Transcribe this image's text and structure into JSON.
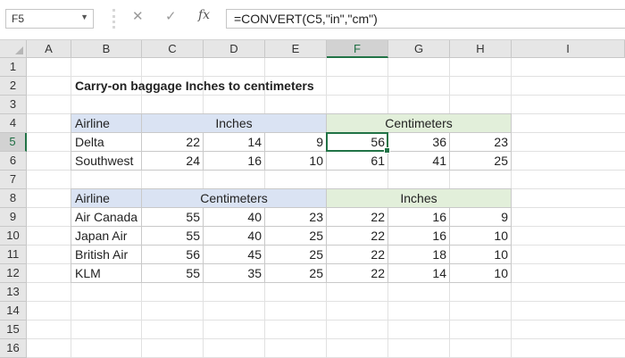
{
  "name_box": {
    "value": "F5",
    "dropdown_icon": "chevron-down-icon"
  },
  "formula_bar": {
    "cancel_icon": "close-icon",
    "enter_icon": "check-icon",
    "fx_label": "fx",
    "formula": "=CONVERT(C5,\"in\",\"cm\")"
  },
  "columns": [
    "A",
    "B",
    "C",
    "D",
    "E",
    "F",
    "G",
    "H",
    "I"
  ],
  "rows": [
    "1",
    "2",
    "3",
    "4",
    "5",
    "6",
    "7",
    "8",
    "9",
    "10",
    "11",
    "12",
    "13",
    "14",
    "15",
    "16"
  ],
  "selected": {
    "column": "F",
    "row": "5"
  },
  "colors": {
    "accent": "#217346",
    "blue_header": "#dae3f3",
    "green_header": "#e2efda"
  },
  "title": "Carry-on baggage Inches to centimeters",
  "table1": {
    "airline_header": "Airline",
    "group1_header": "Inches",
    "group2_header": "Centimeters",
    "rows": [
      {
        "airline": "Delta",
        "a": "22",
        "b": "14",
        "c": "9",
        "d": "56",
        "e": "36",
        "f": "23"
      },
      {
        "airline": "Southwest",
        "a": "24",
        "b": "16",
        "c": "10",
        "d": "61",
        "e": "41",
        "f": "25"
      }
    ]
  },
  "table2": {
    "airline_header": "Airline",
    "group1_header": "Centimeters",
    "group2_header": "Inches",
    "rows": [
      {
        "airline": "Air Canada",
        "a": "55",
        "b": "40",
        "c": "23",
        "d": "22",
        "e": "16",
        "f": "9"
      },
      {
        "airline": "Japan Air",
        "a": "55",
        "b": "40",
        "c": "25",
        "d": "22",
        "e": "16",
        "f": "10"
      },
      {
        "airline": "British Air",
        "a": "56",
        "b": "45",
        "c": "25",
        "d": "22",
        "e": "18",
        "f": "10"
      },
      {
        "airline": "KLM",
        "a": "55",
        "b": "35",
        "c": "25",
        "d": "22",
        "e": "14",
        "f": "10"
      }
    ]
  }
}
